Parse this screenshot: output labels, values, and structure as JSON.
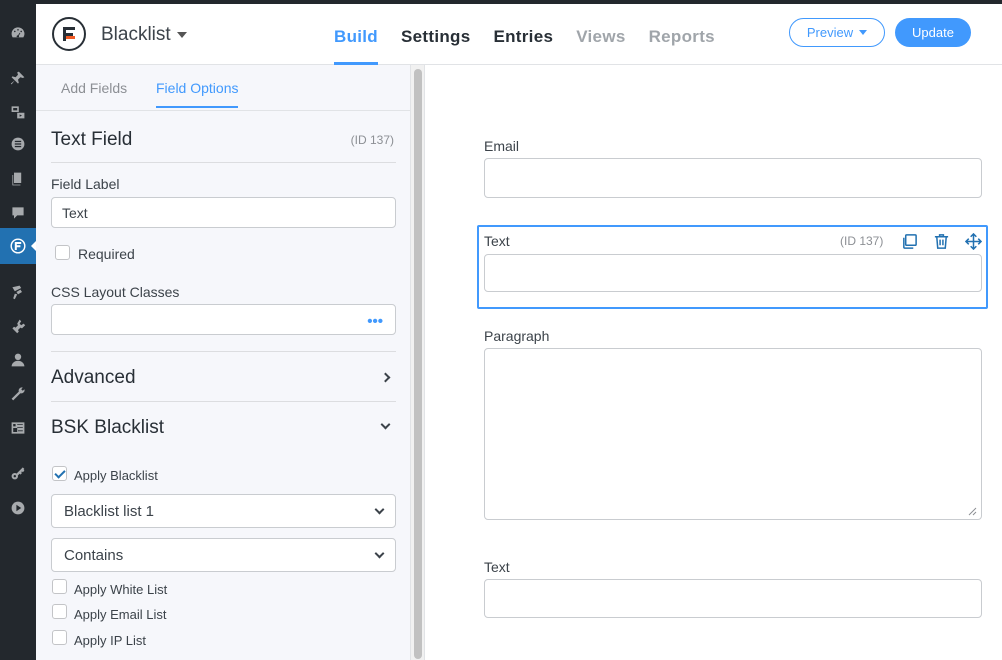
{
  "app": {
    "form_title": "Blacklist",
    "nav": [
      {
        "label": "Build",
        "state": "active"
      },
      {
        "label": "Settings",
        "state": "normal"
      },
      {
        "label": "Entries",
        "state": "normal"
      },
      {
        "label": "Views",
        "state": "disabled"
      },
      {
        "label": "Reports",
        "state": "disabled"
      }
    ],
    "preview_label": "Preview",
    "update_label": "Update",
    "accent_color": "#4199fd"
  },
  "wp_sidebar": {
    "icons": [
      "dashboard-icon",
      "pin-icon",
      "media-icon",
      "forms-icon",
      "pages-icon",
      "comments-icon",
      "formidable-icon",
      "appearance-icon",
      "plugins-icon",
      "users-icon",
      "tools-icon",
      "settings-icon",
      "key-icon",
      "play-icon"
    ],
    "active_icon": "formidable-icon"
  },
  "panel": {
    "tabs": [
      "Add Fields",
      "Field Options"
    ],
    "active_tab": "Field Options",
    "field_type": "Text Field",
    "field_id": "(ID 137)",
    "field_label_caption": "Field Label",
    "field_label_value": "Text",
    "required_label": "Required",
    "css_classes_caption": "CSS Layout Classes",
    "css_classes_value": "",
    "advanced_label": "Advanced",
    "bsk_section_label": "BSK Blacklist",
    "apply_blacklist_label": "Apply Blacklist",
    "apply_blacklist_checked": true,
    "blacklist_select": "Blacklist list 1",
    "match_select": "Contains",
    "apply_white_list_label": "Apply White List",
    "apply_email_list_label": "Apply Email List",
    "apply_ip_list_label": "Apply IP List"
  },
  "canvas": {
    "fields": [
      {
        "label": "Email",
        "type": "text"
      },
      {
        "label": "Text",
        "type": "text",
        "selected": true,
        "id": "(ID 137)"
      },
      {
        "label": "Paragraph",
        "type": "textarea"
      },
      {
        "label": "Text",
        "type": "text"
      }
    ]
  }
}
